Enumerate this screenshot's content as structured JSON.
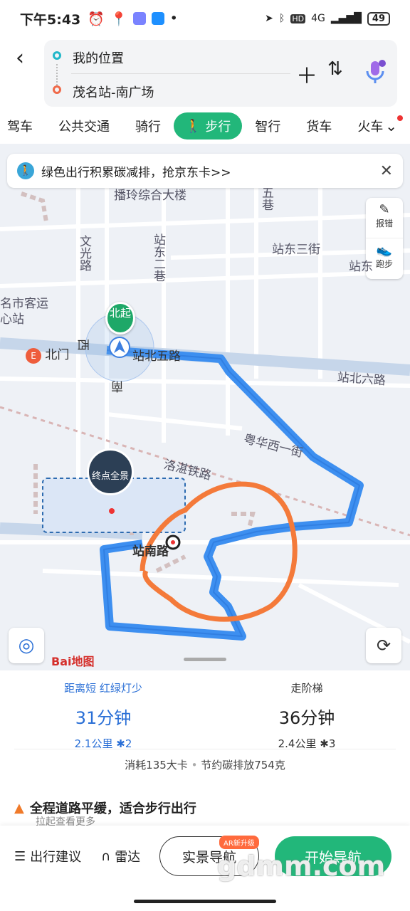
{
  "status": {
    "time": "下午5:43",
    "network": "4G",
    "battery": "49"
  },
  "route": {
    "from": "我的位置",
    "to": "茂名站-南广场"
  },
  "tabs": [
    "驾车",
    "公共交通",
    "骑行",
    "步行",
    "智行",
    "货车",
    "火车"
  ],
  "active_tab": "步行",
  "banner": {
    "text": "绿色出行积累碳减排，抢京东卡>>"
  },
  "side_buttons": {
    "report": "报错",
    "run": "跑步"
  },
  "map_labels": {
    "l1": "播玲综合大楼",
    "l2": "五巷",
    "l3": "文光路",
    "l4": "站东二巷",
    "l5": "站东三街",
    "l6": "站东",
    "l7": "名市客运心站",
    "l8": "北门",
    "l9": "站北五路",
    "l10": "站北六路",
    "l11": "粤华西一街",
    "l12": "洛湛铁路",
    "l13": "站南路",
    "l14": "西",
    "l15": "南",
    "start": "北起",
    "pano": "终点全景",
    "logo": "Bai地图"
  },
  "options": [
    {
      "tag": "距离短 红绿灯少",
      "duration": "31分钟",
      "distance": "2.1公里",
      "lights": "2"
    },
    {
      "tag": "走阶梯",
      "duration": "36分钟",
      "distance": "2.4公里",
      "lights": "3"
    }
  ],
  "info": {
    "calories": "消耗135大卡",
    "carbon": "节约碳排放754克"
  },
  "tip": {
    "title": "全程道路平缓，适合步行出行",
    "sub": "拉起查看更多"
  },
  "bottom": {
    "advice": "出行建议",
    "radar": "雷达",
    "ar": "实景导航",
    "ar_badge": "AR新升级",
    "start": "开始导航"
  },
  "watermark": "gdmm.com",
  "colors": {
    "green": "#22b77a",
    "route": "#3d8ff0",
    "annotation": "#f47a3a"
  }
}
